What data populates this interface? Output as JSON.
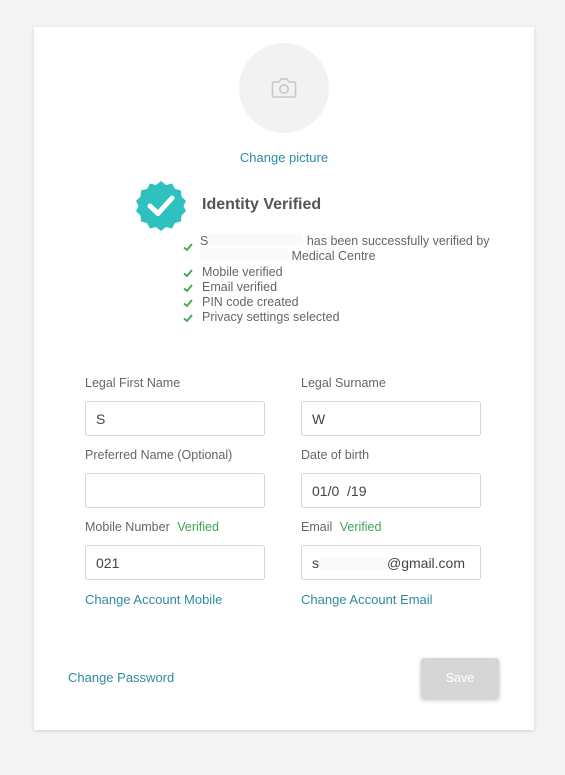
{
  "profile": {
    "change_picture": "Change picture"
  },
  "identity": {
    "title": "Identity Verified",
    "message_name": "S",
    "message_text": "has been successfully verified by",
    "message_org": "Medical Centre",
    "checks": [
      "Mobile verified",
      "Email verified",
      "PIN code created",
      "Privacy settings selected"
    ]
  },
  "form": {
    "first_name_label": "Legal First Name",
    "first_name_value": "S",
    "surname_label": "Legal Surname",
    "surname_value": "W",
    "preferred_label": "Preferred Name (Optional)",
    "preferred_value": "",
    "dob_label": "Date of birth",
    "dob_value": "01/0  /19",
    "mobile_label": "Mobile Number",
    "mobile_verified": "Verified",
    "mobile_value": "021",
    "email_label": "Email",
    "email_verified": "Verified",
    "email_value_start": "s",
    "email_value_end": "@gmail.com",
    "change_mobile": "Change Account Mobile",
    "change_email": "Change Account Email"
  },
  "actions": {
    "change_password": "Change Password",
    "save": "Save"
  },
  "colors": {
    "accent": "#2e8ba0",
    "verified": "#3aa655",
    "badge": "#2fc0c0"
  }
}
